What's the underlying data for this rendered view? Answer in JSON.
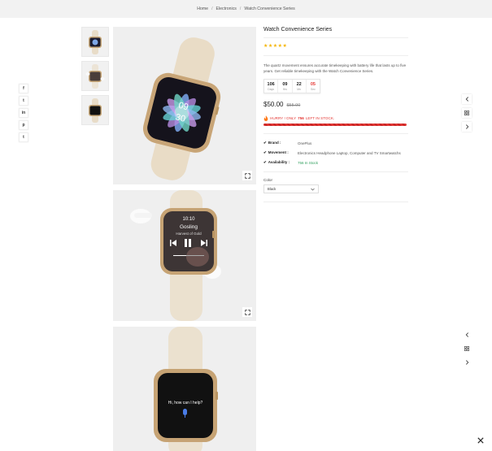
{
  "breadcrumb": {
    "home": "Home",
    "category": "Electronics",
    "current": "Watch Convenience Series"
  },
  "social": [
    {
      "icon": "facebook-icon",
      "glyph": "f"
    },
    {
      "icon": "twitter-icon",
      "glyph": "t"
    },
    {
      "icon": "linkedin-icon",
      "glyph": "in"
    },
    {
      "icon": "pinterest-icon",
      "glyph": "p"
    },
    {
      "icon": "tumblr-icon",
      "glyph": "t"
    }
  ],
  "gallery": {
    "img1": {
      "time_top": "09",
      "time_bottom": "30"
    },
    "img2": {
      "clock": "10:10",
      "song": "Gosling",
      "album": "Harvest of Gold"
    },
    "img3": {
      "prompt": "Hi, how can I help?"
    }
  },
  "product": {
    "title": "Watch Convenience Series",
    "stars": "★★★★★",
    "description": "The quartz movement ensures accurate timekeeping with battery life that lasts up to five years. Get reliable timekeeping with the Watch Convenience Series.",
    "countdown": [
      {
        "value": "106",
        "label": "Days"
      },
      {
        "value": "09",
        "label": "Hrs"
      },
      {
        "value": "22",
        "label": "Mn"
      },
      {
        "value": "05",
        "label": "Sec"
      }
    ],
    "price": "$50.00",
    "old_price": "$55.00",
    "hurry_prefix": "HURRY ! ONLY",
    "hurry_count": "756",
    "hurry_suffix": "LEFT IN STOCK.",
    "stock_fraction": 1.0,
    "meta": {
      "brand_label": "Brand :",
      "brand_value": "OnePlus",
      "movement_label": "Movement :",
      "movement_value": "Electronics Headphone Laptop, Computer and TV Smartwatchs",
      "availability_label": "Availability :",
      "availability_value": "756 In Stock"
    },
    "color_label": "Color",
    "color_selected": "Black"
  },
  "colors": {
    "accent_red": "#e53935",
    "star": "#f5b400",
    "in_stock": "#2e9e5b"
  }
}
